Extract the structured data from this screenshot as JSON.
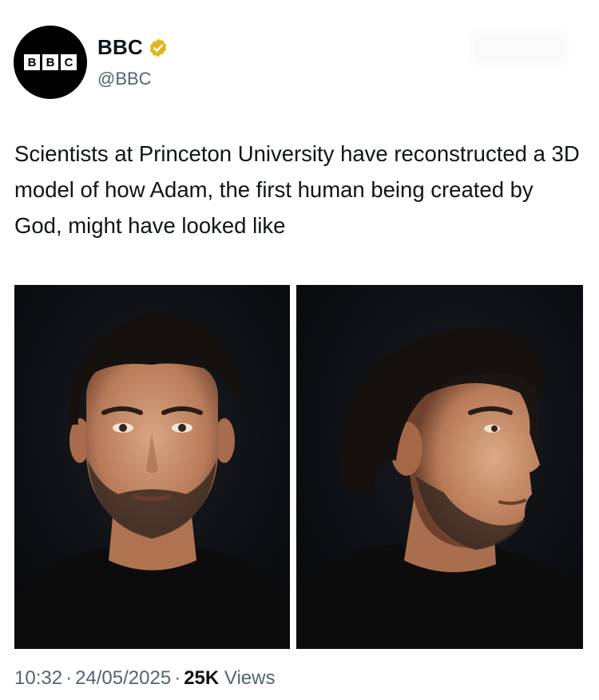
{
  "account": {
    "display_name": "BBC",
    "handle": "@BBC",
    "logo_letters": [
      "B",
      "B",
      "C"
    ],
    "verified": true,
    "verified_color": "#e2b719"
  },
  "tweet": {
    "text": "Scientists at Princeton University have reconstructed a 3D model of how Adam, the first human being created by God, might have looked like"
  },
  "media": {
    "images": [
      {
        "icon": "front-face-portrait"
      },
      {
        "icon": "profile-face-portrait"
      }
    ]
  },
  "meta": {
    "time": "10:32",
    "date": "24/05/2025",
    "separator": "·",
    "views_count": "25K",
    "views_label": "Views"
  }
}
